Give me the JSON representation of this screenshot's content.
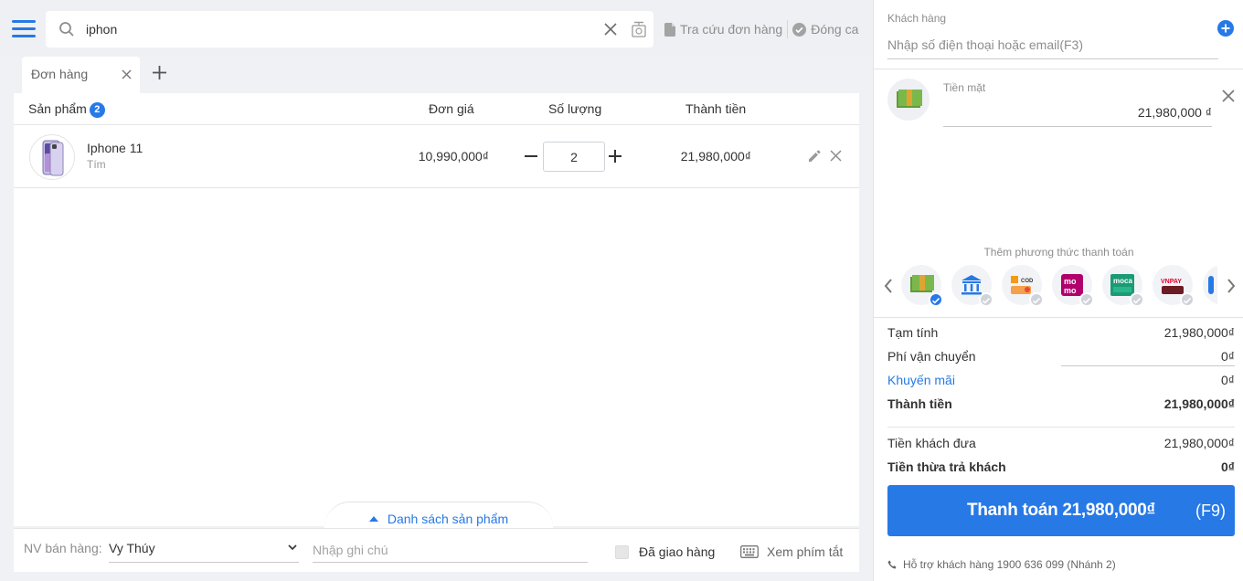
{
  "search": {
    "value": "iphon",
    "lookup_label": "Tra cứu đơn hàng",
    "close_shift_label": "Đóng ca"
  },
  "tabs": [
    {
      "label": "Đơn hàng"
    }
  ],
  "table": {
    "headers": {
      "product": "Sản phẩm",
      "count": "2",
      "unit_price": "Đơn giá",
      "quantity": "Số lượng",
      "total": "Thành tiền"
    },
    "rows": [
      {
        "name": "Iphone 11",
        "variant": "Tím",
        "unit_price": "10,990,000₫",
        "quantity": "2",
        "total": "21,980,000₫"
      }
    ]
  },
  "product_list_label": "Danh sách sản phẩm",
  "bottom": {
    "staff_label": "NV bán hàng:",
    "staff_value": "Vy Thúy",
    "note_placeholder": "Nhập ghi chú",
    "delivered_label": "Đã giao hàng",
    "shortcuts_label": "Xem phím tắt"
  },
  "customer": {
    "label": "Khách hàng",
    "placeholder": "Nhập số điện thoại hoặc email(F3)"
  },
  "payment": {
    "method_label": "Tiền mặt",
    "amount": "21,980,000 ₫",
    "add_method_label": "Thêm phương thức thanh toán",
    "methods": [
      {
        "name": "cash",
        "selected": true
      },
      {
        "name": "bank-transfer",
        "selected": false
      },
      {
        "name": "cod",
        "label": "COD",
        "selected": false
      },
      {
        "name": "momo",
        "label": "mo mo",
        "selected": false
      },
      {
        "name": "moca",
        "label": "moca",
        "selected": false
      },
      {
        "name": "vnpay",
        "label": "VNPAY",
        "selected": false
      }
    ]
  },
  "summary": {
    "subtotal_label": "Tạm tính",
    "subtotal": "21,980,000₫",
    "shipping_label": "Phí vận chuyển",
    "shipping": "0₫",
    "promo_label": "Khuyến mãi",
    "promo": "0₫",
    "total_label": "Thành tiền",
    "total": "21,980,000₫",
    "given_label": "Tiền khách đưa",
    "given": "21,980,000₫",
    "change_label": "Tiền thừa trả khách",
    "change": "0₫"
  },
  "pay_button": {
    "label": "Thanh toán 21,980,000₫",
    "shortcut": "(F9)"
  },
  "support": "Hỗ trợ khách hàng 1900 636 099 (Nhánh 2)",
  "colors": {
    "accent": "#2779e6"
  }
}
